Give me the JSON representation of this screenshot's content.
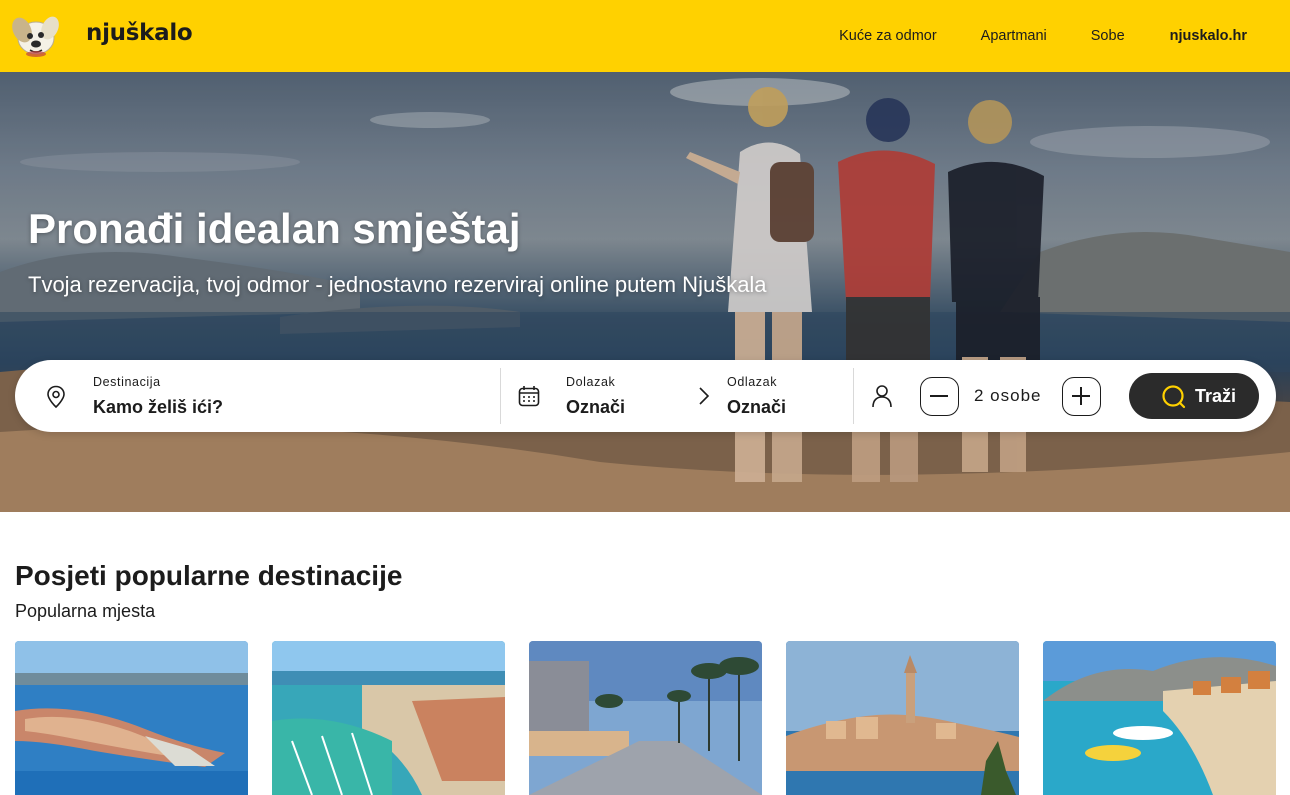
{
  "brand": {
    "name": "njuškalo"
  },
  "nav": [
    {
      "label": "Kuće za odmor"
    },
    {
      "label": "Apartmani"
    },
    {
      "label": "Sobe"
    },
    {
      "label": "njuskalo.hr"
    }
  ],
  "hero": {
    "title": "Pronađi idealan smještaj",
    "subtitle": "Tvoja rezervacija, tvoj odmor - jednostavno rezerviraj online putem Njuškala"
  },
  "search": {
    "destination": {
      "label": "Destinacija",
      "placeholder": "Kamo želiš ići?",
      "icon": "location-pin-icon"
    },
    "arrival": {
      "label": "Dolazak",
      "value": "Označi",
      "icon": "calendar-icon"
    },
    "departure": {
      "label": "Odlazak",
      "value": "Označi"
    },
    "guests": {
      "value": "2 osobe",
      "icon": "person-icon"
    },
    "submit_label": "Traži",
    "accent": "#ffd100"
  },
  "popular": {
    "title": "Posjeti popularne destinacije",
    "subtitle": "Popularna mjesta",
    "cards": [
      {
        "image": "aerial-coastal-town-peninsula"
      },
      {
        "image": "marina-with-boats"
      },
      {
        "image": "promenade-with-palm-trees"
      },
      {
        "image": "old-town-on-peninsula-with-church-tower"
      },
      {
        "image": "harbour-with-boats-and-mountains"
      }
    ]
  },
  "colors": {
    "brand_yellow": "#ffd100",
    "dark": "#2b2b2b"
  }
}
